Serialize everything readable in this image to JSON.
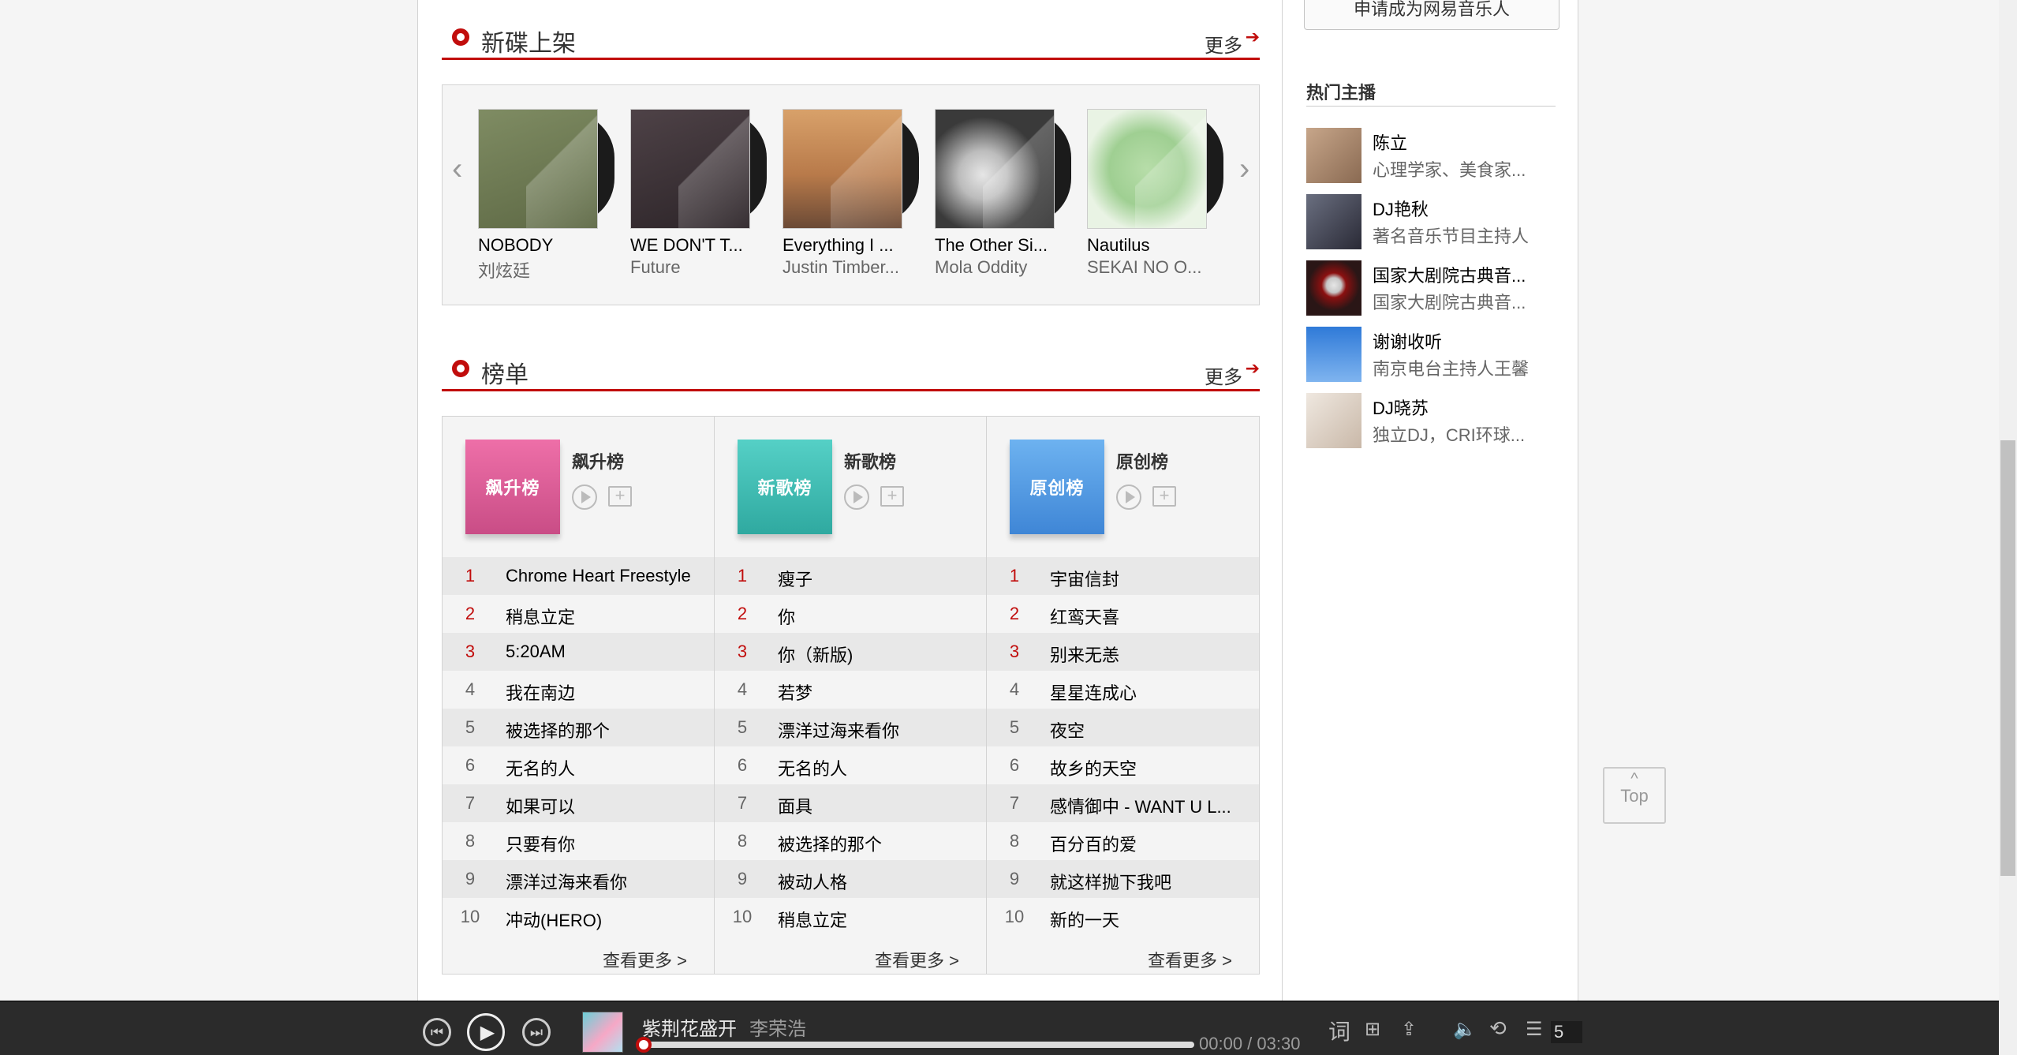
{
  "new_albums": {
    "title": "新碟上架",
    "more": "更多",
    "items": [
      {
        "name": "NOBODY",
        "artist": "刘炫廷",
        "cover_color": "#6f7a55"
      },
      {
        "name": "WE DON'T T...",
        "artist": "Future",
        "cover_color": "#3b3035"
      },
      {
        "name": "Everything I ...",
        "artist": "Justin Timber...",
        "cover_color": "#c98a52"
      },
      {
        "name": "The Other Si...",
        "artist": "Mola Oddity",
        "cover_color": "#4a4a4a"
      },
      {
        "name": "Nautilus",
        "artist": "SEKAI NO O...",
        "cover_color": "#a9d3a0"
      }
    ]
  },
  "charts": {
    "title": "榜单",
    "more": "更多",
    "see_more": "查看更多 >",
    "lists": [
      {
        "name": "飙升榜",
        "cover_label": "飙升榜",
        "color": "#e8579b",
        "songs": [
          "Chrome Heart Freestyle",
          "稍息立定",
          "5:20AM",
          "我在南边",
          "被选择的那个",
          "无名的人",
          "如果可以",
          "只要有你",
          "漂洋过海来看你",
          "冲动(HERO)"
        ]
      },
      {
        "name": "新歌榜",
        "cover_label": "新歌榜",
        "color": "#3fc0b7",
        "songs": [
          "瘦子",
          "你",
          "你（新版)",
          "若梦",
          "漂洋过海来看你",
          "无名的人",
          "面具",
          "被选择的那个",
          "被动人格",
          "稍息立定"
        ]
      },
      {
        "name": "原创榜",
        "cover_label": "原创榜",
        "color": "#4d9fe8",
        "songs": [
          "宇宙信封",
          "红鸾天喜",
          "别来无恙",
          "星星连成心",
          "夜空",
          "故乡的天空",
          "感情御中 - WANT U L...",
          "百分百的爱",
          "就这样抛下我吧",
          "新的一天"
        ]
      }
    ]
  },
  "sidebar": {
    "apply_button": "申请成为网易音乐人",
    "hot_djs_title": "热门主播",
    "djs": [
      {
        "name": "陈立",
        "desc": "心理学家、美食家...",
        "color": "#a8836a"
      },
      {
        "name": "DJ艳秋",
        "desc": "著名音乐节目主持人",
        "color": "#3b3b4a"
      },
      {
        "name": "国家大剧院古典音...",
        "desc": "国家大剧院古典音...",
        "color": "#2a1616"
      },
      {
        "name": "谢谢收听",
        "desc": "南京电台主持人王馨",
        "color": "#4b8fe0"
      },
      {
        "name": "DJ晓苏",
        "desc": "独立DJ，CRI环球...",
        "color": "#d9cfc4"
      }
    ]
  },
  "back_to_top": {
    "caret": "^",
    "label": "Top"
  },
  "player": {
    "song": "紫荆花盛开",
    "artist": "李荣浩",
    "time": "00:00 / 03:30",
    "progress": 0,
    "lyrics_icon": "词",
    "playlist_count": "5"
  }
}
